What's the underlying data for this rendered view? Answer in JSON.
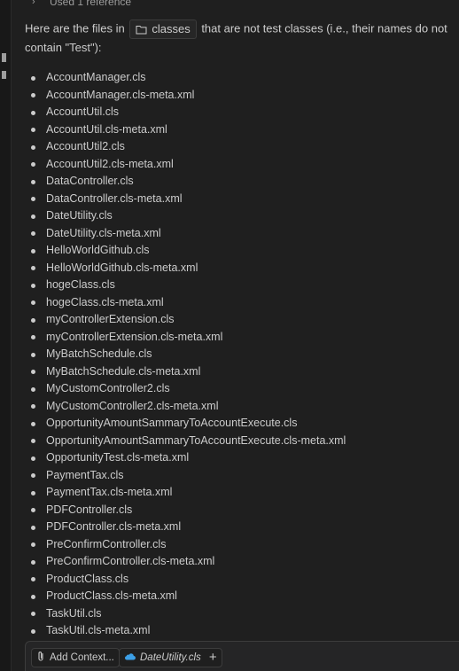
{
  "reference": {
    "label": "Used 1 reference"
  },
  "intro": {
    "before": "Here are the files in ",
    "folder": "classes",
    "after": " that are not test classes (i.e., their names do not contain \"Test\"):"
  },
  "files": [
    "AccountManager.cls",
    "AccountManager.cls-meta.xml",
    "AccountUtil.cls",
    "AccountUtil.cls-meta.xml",
    "AccountUtil2.cls",
    "AccountUtil2.cls-meta.xml",
    "DataController.cls",
    "DataController.cls-meta.xml",
    "DateUtility.cls",
    "DateUtility.cls-meta.xml",
    "HelloWorldGithub.cls",
    "HelloWorldGithub.cls-meta.xml",
    "hogeClass.cls",
    "hogeClass.cls-meta.xml",
    "myControllerExtension.cls",
    "myControllerExtension.cls-meta.xml",
    "MyBatchSchedule.cls",
    "MyBatchSchedule.cls-meta.xml",
    "MyCustomController2.cls",
    "MyCustomController2.cls-meta.xml",
    "OpportunityAmountSammaryToAccountExecute.cls",
    "OpportunityAmountSammaryToAccountExecute.cls-meta.xml",
    "OpportunityTest.cls-meta.xml",
    "PaymentTax.cls",
    "PaymentTax.cls-meta.xml",
    "PDFController.cls",
    "PDFController.cls-meta.xml",
    "PreConfirmController.cls",
    "PreConfirmController.cls-meta.xml",
    "ProductClass.cls",
    "ProductClass.cls-meta.xml",
    "TaskUtil.cls",
    "TaskUtil.cls-meta.xml"
  ],
  "input": {
    "add_context_label": "Add Context...",
    "current_file": "DateUtility.cls",
    "add_symbol": "+"
  },
  "colors": {
    "background": "#1f1f1f",
    "text": "#cccccc",
    "muted": "#9d9d9d",
    "salesforce_blue": "#3c9fe6"
  }
}
